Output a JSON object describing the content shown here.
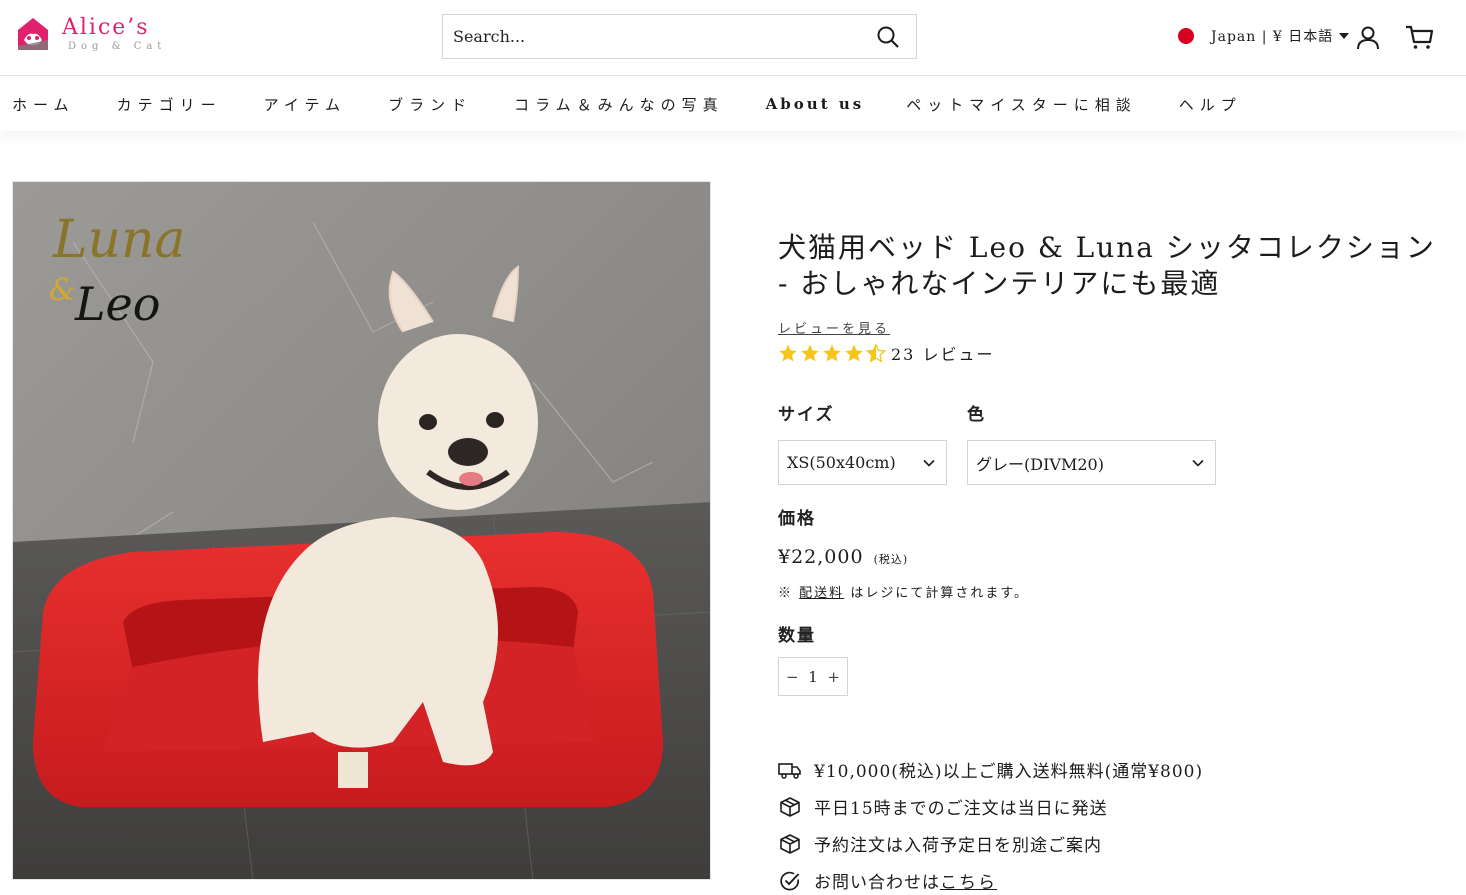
{
  "brand": {
    "name": "Alice’s",
    "tagline": "Dog & Cat",
    "accent": "#e2216e"
  },
  "search": {
    "placeholder": "Search..."
  },
  "locale": {
    "label": "Japan | ¥ 日本語",
    "flag_color": "#d7001f"
  },
  "nav": {
    "items": [
      "ホーム",
      "カテゴリー",
      "アイテム",
      "ブランド",
      "コラム＆みんなの写真",
      "About us",
      "ペットマイスターに相談",
      "ヘルプ"
    ]
  },
  "product": {
    "image_logo_text_1": "Luna",
    "image_logo_text_2": "&",
    "image_logo_text_3": "Leo",
    "title": "犬猫用ベッド Leo & Luna シッタコレクション - おしゃれなインテリアにも最適",
    "review_link": "レビューを見る",
    "rating": 4.5,
    "rating_text": "23 レビュー",
    "size_label": "サイズ",
    "size_value": "XS(50x40cm)",
    "color_label": "色",
    "color_value": "グレー(DIVM20)",
    "price_label": "価格",
    "price": "¥22,000",
    "tax_note": "(税込)",
    "ship_prefix": "※",
    "ship_link": "配送料",
    "ship_suffix": "はレジにて計算されます。",
    "qty_label": "数量",
    "qty_minus": "−",
    "qty_value": "1",
    "qty_plus": "+",
    "bed_color": "#e02024",
    "star_color": "#f5c518"
  },
  "perks": [
    {
      "icon": "truck-icon",
      "text": "¥10,000(税込)以上ご購入送料無料(通常¥800)"
    },
    {
      "icon": "package-icon",
      "text": "平日15時までのご注文は当日に発送"
    },
    {
      "icon": "package-icon",
      "text": "予約注文は入荷予定日を別途ご案内"
    },
    {
      "icon": "check-circle-icon",
      "text": "お問い合わせは",
      "link": "こちら"
    }
  ]
}
